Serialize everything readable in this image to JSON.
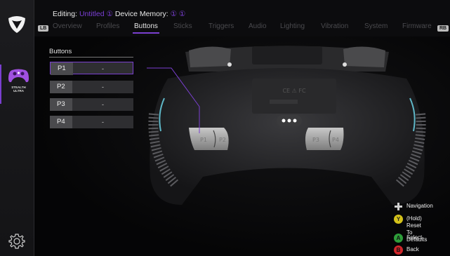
{
  "app": {
    "device_label": "STEALTH\nULTRA"
  },
  "header": {
    "editing_label": "Editing:",
    "editing_value": "Untitled ①",
    "memory_label": "Device Memory:",
    "memory_value": "① ①",
    "lb": "LB",
    "rb": "RB",
    "tabs": [
      {
        "label": "Overview",
        "active": false
      },
      {
        "label": "Profiles",
        "active": false
      },
      {
        "label": "Buttons",
        "active": true
      },
      {
        "label": "Sticks",
        "active": false
      },
      {
        "label": "Triggers",
        "active": false
      },
      {
        "label": "Audio",
        "active": false
      },
      {
        "label": "Lighting",
        "active": false
      },
      {
        "label": "Vibration",
        "active": false
      },
      {
        "label": "System",
        "active": false
      },
      {
        "label": "Firmware",
        "active": false
      }
    ]
  },
  "buttons": {
    "title": "Buttons",
    "rows": [
      {
        "label": "P1",
        "value": "-",
        "selected": true
      },
      {
        "label": "P2",
        "value": "-",
        "selected": false
      },
      {
        "label": "P3",
        "value": "-",
        "selected": false
      },
      {
        "label": "P4",
        "value": "-",
        "selected": false
      }
    ]
  },
  "controller": {
    "paddle_left_outer": "P1",
    "paddle_left_inner": "P2",
    "paddle_right_inner": "P4",
    "paddle_right_outer": "P3",
    "brand_text": "TURTLE BEACH"
  },
  "legend": [
    {
      "icon": "dpad-icon",
      "glyph": "",
      "text": "Navigation",
      "color": "#cfcfcf"
    },
    {
      "icon": "y-button-icon",
      "glyph": "Y",
      "text": "(Hold) Reset\nTo Defaults",
      "color": "#d4c21a"
    },
    {
      "icon": "a-button-icon",
      "glyph": "A",
      "text": "Select",
      "color": "#2e9e3a"
    },
    {
      "icon": "b-button-icon",
      "glyph": "B",
      "text": "Back",
      "color": "#d0262a"
    }
  ],
  "colors": {
    "accent": "#7a3fd0",
    "background": "#000000"
  }
}
